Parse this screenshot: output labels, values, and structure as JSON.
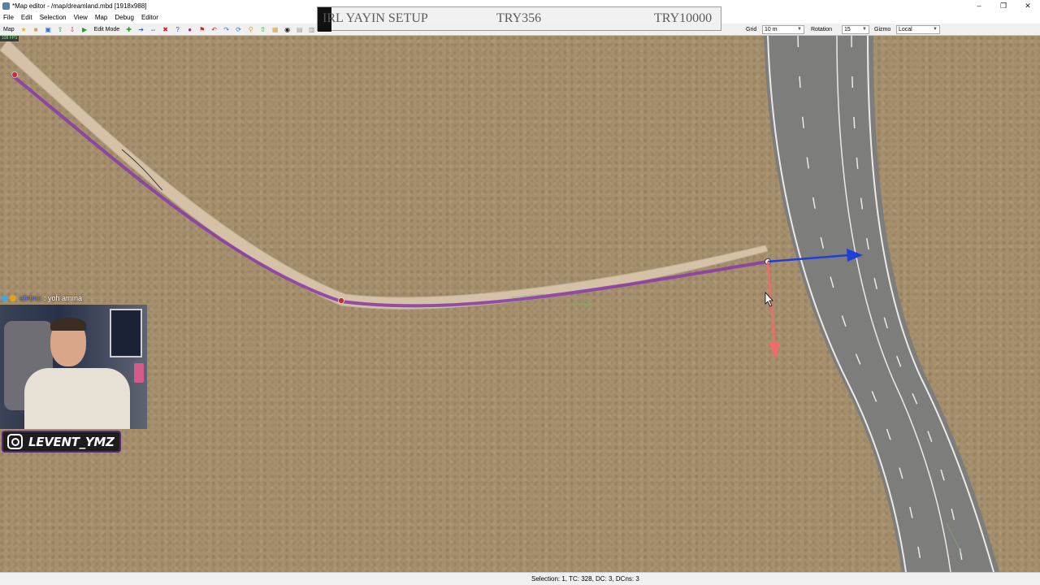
{
  "window": {
    "title": "*Map editor - /map/dreamland.mbd [1918x988]",
    "controls": [
      "–",
      "❐",
      "✕"
    ]
  },
  "menu": [
    "File",
    "Edit",
    "Selection",
    "View",
    "Map",
    "Debug",
    "Editor"
  ],
  "toolbar": {
    "map_label": "Map",
    "edit_mode_label": "Edit Mode",
    "grid_label": "Grid",
    "grid_value": "10 m",
    "rotation_label": "Rotation",
    "rotation_value": "15",
    "gizmo_label": "Gizmo",
    "gizmo_value": "Local"
  },
  "viewport": {
    "fps": "108 FPS"
  },
  "status": {
    "text": "Selection: 1, TC: 328, DC: 3, DCns: 3"
  },
  "overlay": {
    "banner": {
      "left_text": "IRL YAYIN SETUP",
      "mid_text": "TRY356",
      "right_text": "TRY10000"
    },
    "chat": {
      "user": "efetmc",
      "message": ": yoh amına"
    },
    "instagram_handle": "LEVENT_YMZ"
  },
  "colors": {
    "ground": "#a68f6c",
    "road_path": "#d6c3aa",
    "selection": "#8b3fa8",
    "gizmo_x": "#1f3ddb",
    "gizmo_y": "#f26a6a",
    "asphalt": "#7c7c7c"
  }
}
